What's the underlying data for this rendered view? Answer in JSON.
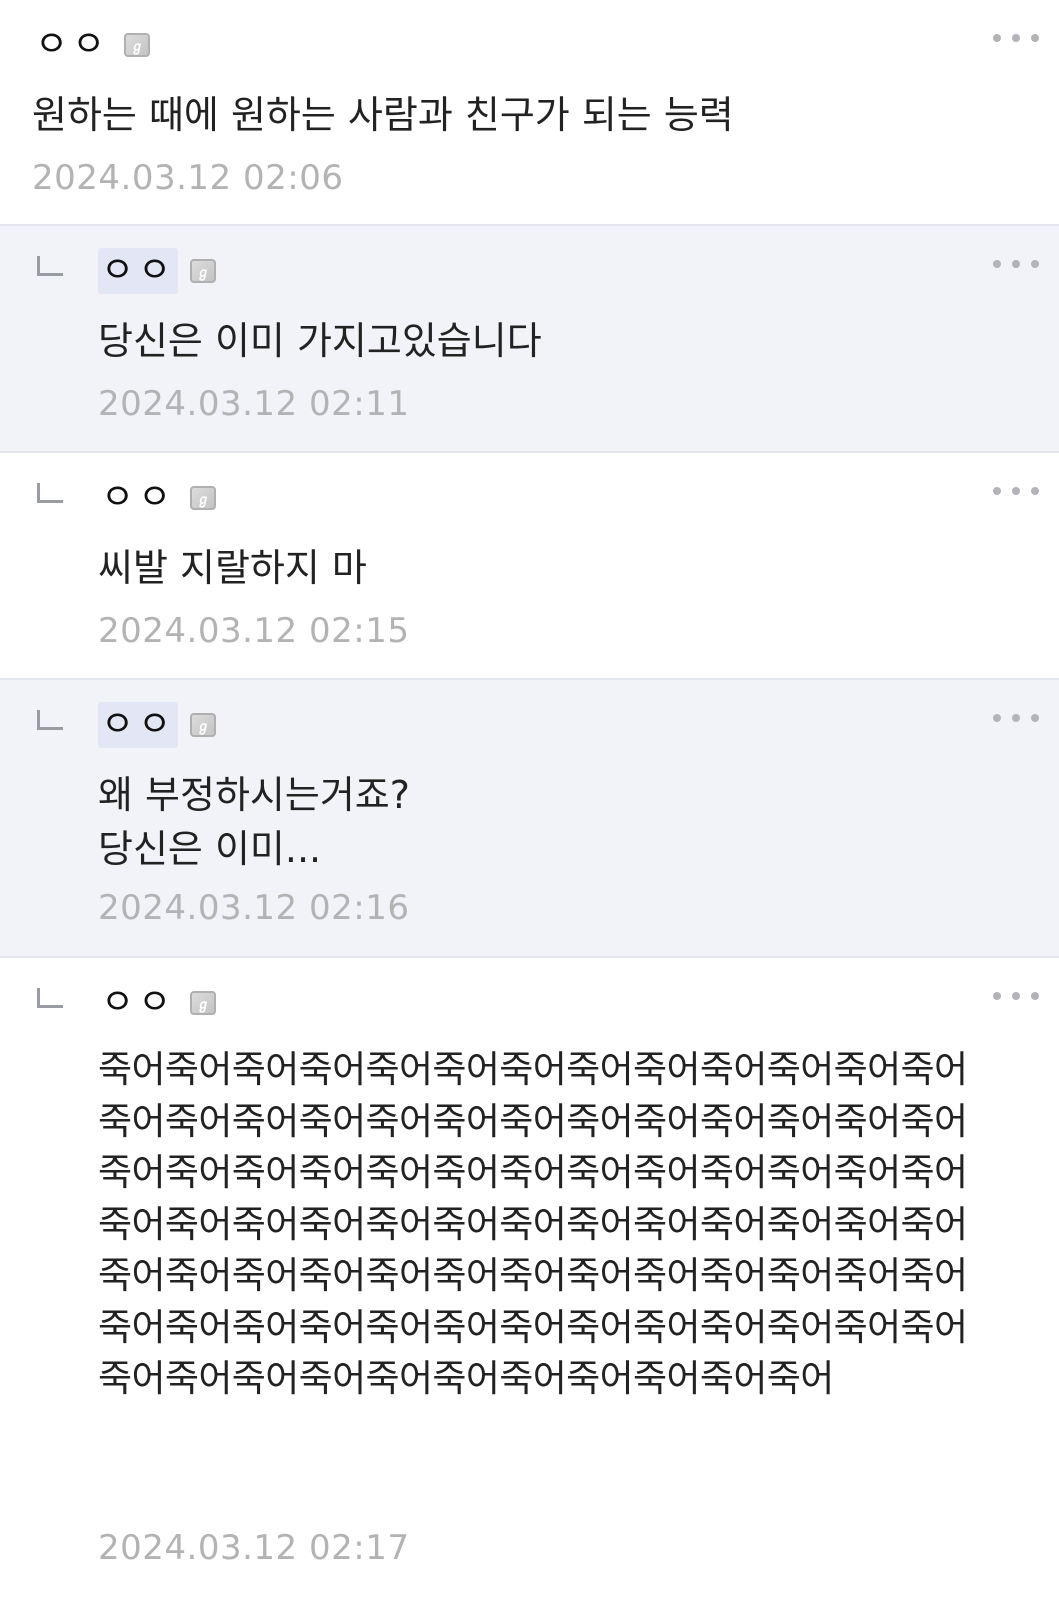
{
  "comments": [
    {
      "author": "ㅇㅇ",
      "text": "원하는 때에 원하는 사람과 친구가 되는 능력",
      "time": "2024.03.12 02:06"
    },
    {
      "author": "ㅇㅇ",
      "text": "당신은 이미 가지고있습니다",
      "time": "2024.03.12 02:11"
    },
    {
      "author": "ㅇㅇ",
      "text": "씨발 지랄하지 마",
      "time": "2024.03.12 02:15"
    },
    {
      "author": "ㅇㅇ",
      "text": "왜 부정하시는거죠?\n당신은 이미...",
      "time": "2024.03.12 02:16"
    },
    {
      "author": "ㅇㅇ",
      "text": "죽어죽어죽어죽어죽어죽어죽어죽어죽어죽어죽어죽어죽어죽어죽어죽어죽어죽어죽어죽어죽어죽어죽어죽어죽어죽어죽어죽어죽어죽어죽어죽어죽어죽어죽어죽어죽어죽어죽어죽어죽어죽어죽어죽어죽어죽어죽어죽어죽어죽어죽어죽어죽어죽어죽어죽어죽어죽어죽어죽어죽어죽어죽어죽어죽어죽어죽어죽어죽어죽어죽어죽어죽어죽어죽어죽어죽어죽어죽어죽어죽어죽어죽어죽어죽어죽어죽어죽어죽어",
      "time": "2024.03.12 02:17"
    }
  ],
  "badge_glyph": "ℊ",
  "colors": {
    "reply_background": "#f1f3f9",
    "divider": "#e4e6ee",
    "author_highlight": "#e3e6f4",
    "timestamp": "#b3b3b6"
  }
}
